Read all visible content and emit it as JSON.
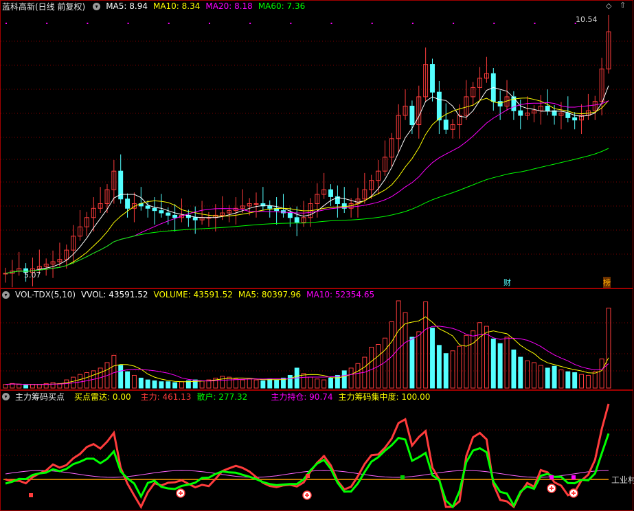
{
  "colors": {
    "bg": "#000000",
    "up": "#ff3c3c",
    "down": "#54ffff",
    "ma5": "#ffffff",
    "ma10": "#ffff00",
    "ma20": "#ff00ff",
    "ma60": "#00ff00",
    "grid": "#7a0000",
    "frame": "#a00000"
  },
  "price": {
    "title": "蓝科高新(日线 前复权)",
    "ma5": "MA5: 8.94",
    "ma10": "MA10: 8.34",
    "ma20": "MA20: 8.18",
    "ma60": "MA60: 7.36",
    "high_label": "10.54",
    "low_label": "5.07",
    "tag_cai": "财",
    "tag_bang": "榜"
  },
  "volume": {
    "title": "VOL-TDX(5,10)",
    "vvol": "VVOL: 43591.52",
    "volume": "VOLUME: 43591.52",
    "ma5": "MA5: 80397.96",
    "ma10": "MA10: 52354.65"
  },
  "indicator": {
    "title": "主力筹码买点",
    "radar": "买点雷达: 0.00",
    "main": "主力: 461.13",
    "retail": "散户: 277.32",
    "hold": "主力持仓: 90.74",
    "concentration": "主力筹码集中度: 100.00",
    "right_label": "工业村"
  },
  "chart_data": [
    {
      "type": "candlestick",
      "title": "蓝科高新(日线 前复权)",
      "y_range": [
        5.07,
        10.54
      ],
      "last": {
        "MA5": 8.94,
        "MA10": 8.34,
        "MA20": 8.18,
        "MA60": 7.36
      },
      "closes": [
        5.1,
        5.15,
        5.2,
        5.12,
        5.2,
        5.25,
        5.3,
        5.35,
        5.4,
        5.6,
        5.9,
        6.1,
        6.3,
        6.5,
        6.6,
        6.9,
        7.3,
        6.7,
        6.5,
        6.6,
        6.55,
        6.5,
        6.45,
        6.4,
        6.35,
        6.3,
        6.35,
        6.3,
        6.25,
        6.3,
        6.3,
        6.35,
        6.4,
        6.45,
        6.5,
        6.55,
        6.6,
        6.6,
        6.55,
        6.5,
        6.45,
        6.4,
        6.3,
        6.2,
        6.3,
        6.6,
        6.8,
        6.9,
        6.75,
        6.6,
        6.5,
        6.6,
        6.7,
        6.9,
        7.1,
        7.3,
        7.6,
        8.0,
        8.5,
        8.7,
        8.3,
        8.9,
        9.6,
        9.0,
        8.4,
        8.2,
        8.3,
        8.5,
        8.9,
        9.1,
        9.3,
        9.4,
        8.8,
        8.7,
        8.9,
        8.6,
        8.5,
        8.55,
        8.6,
        8.7,
        8.6,
        8.5,
        8.55,
        8.45,
        8.4,
        8.5,
        8.6,
        8.8,
        9.5,
        10.3
      ]
    },
    {
      "type": "bar",
      "title": "VOL-TDX(5,10)",
      "last": {
        "VVOL": 43591.52,
        "VOLUME": 43591.52,
        "MA5": 80397.96,
        "MA10": 52354.65
      },
      "values": [
        4,
        5,
        4,
        3,
        4,
        4,
        5,
        6,
        5,
        9,
        12,
        15,
        17,
        19,
        22,
        28,
        36,
        25,
        18,
        14,
        11,
        9,
        8,
        7,
        7,
        6,
        7,
        8,
        9,
        8,
        9,
        11,
        13,
        12,
        10,
        9,
        10,
        9,
        8,
        10,
        9,
        11,
        14,
        22,
        16,
        12,
        10,
        9,
        11,
        14,
        19,
        22,
        27,
        34,
        45,
        48,
        55,
        73,
        96,
        83,
        56,
        62,
        95,
        66,
        47,
        38,
        41,
        46,
        58,
        63,
        72,
        68,
        54,
        49,
        56,
        42,
        34,
        30,
        28,
        25,
        22,
        24,
        20,
        18,
        17,
        15,
        14,
        18,
        32,
        88
      ]
    },
    {
      "type": "line",
      "title": "主力筹码买点",
      "last": {
        "买点雷达": 0.0,
        "主力": 461.13,
        "散户": 277.32,
        "主力持仓": 90.74,
        "主力筹码集中度": 100.0
      }
    }
  ]
}
